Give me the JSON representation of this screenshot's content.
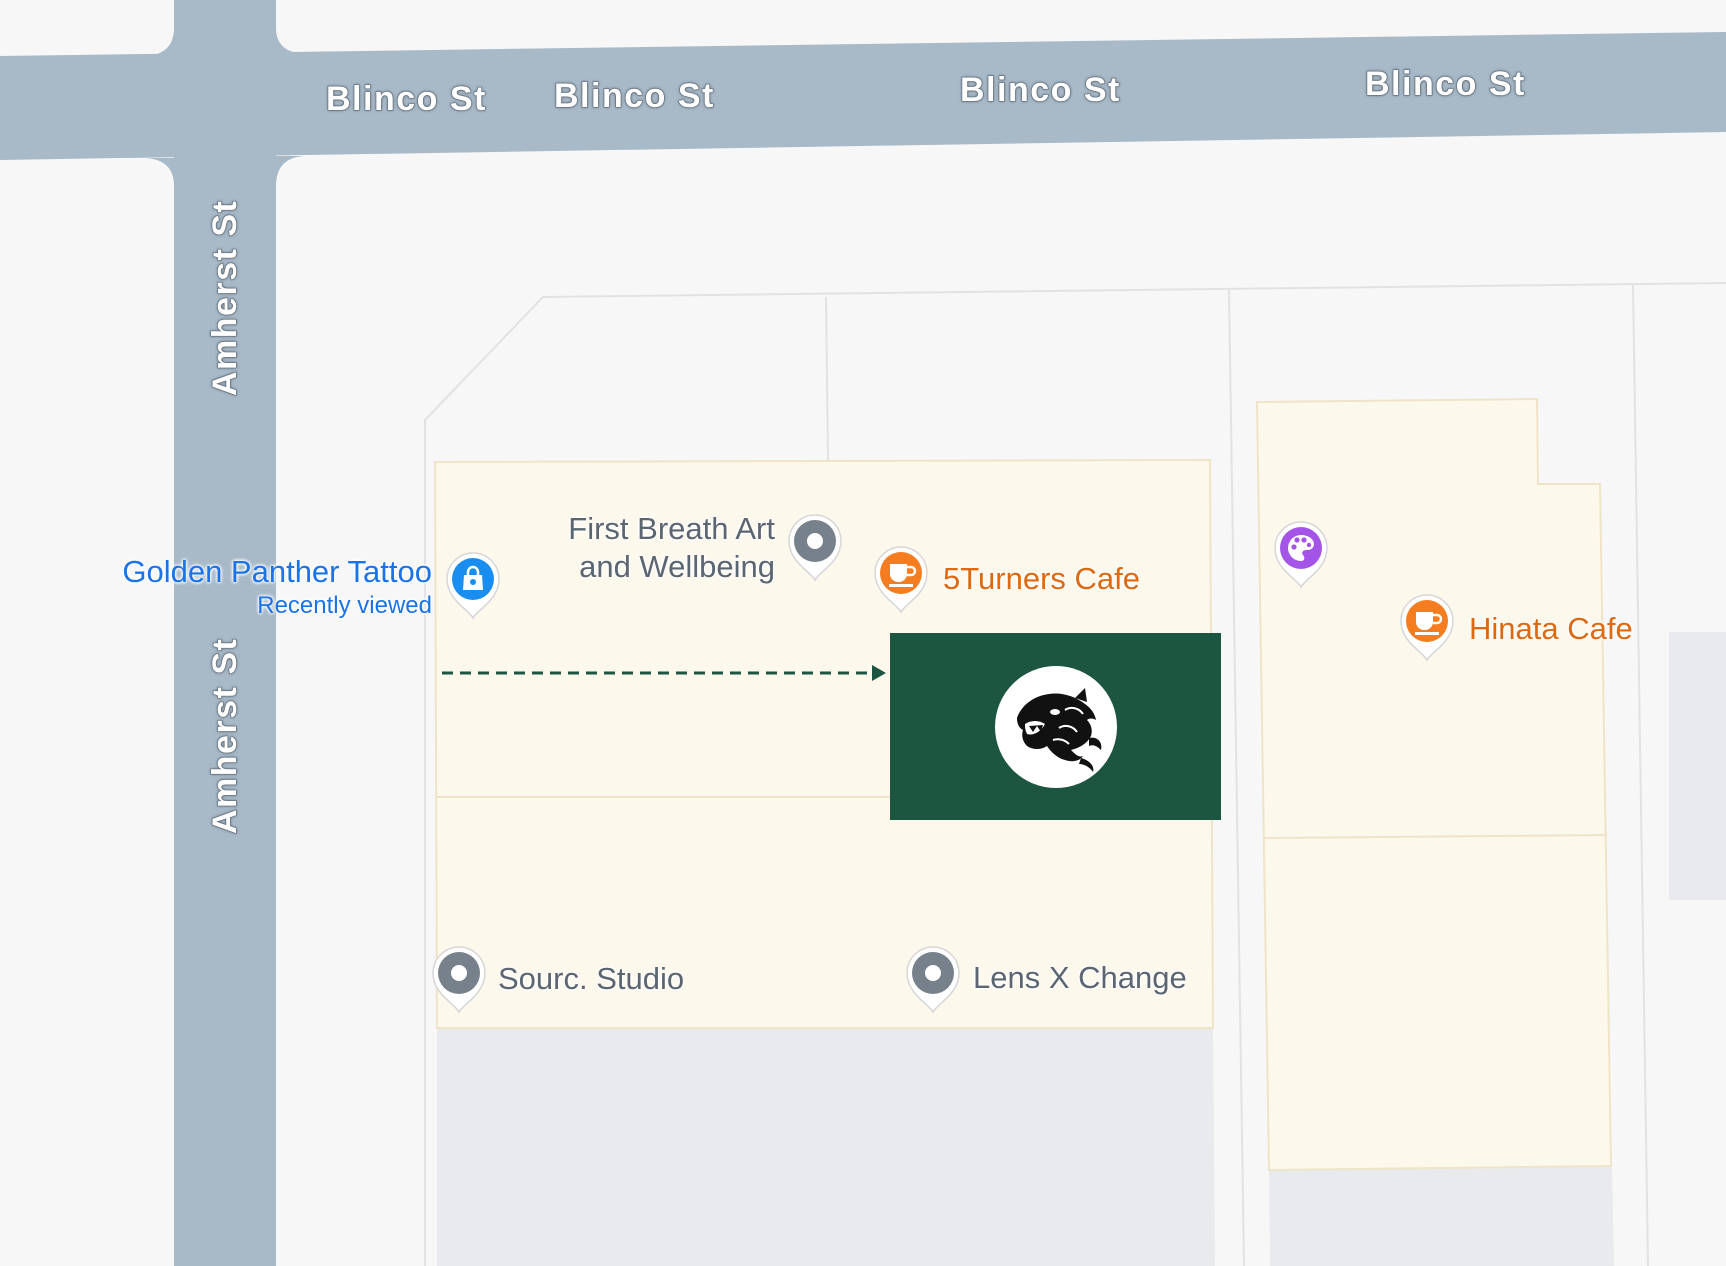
{
  "colors": {
    "road": "#a8b9c8",
    "background": "#f7f7f7",
    "building": "#fdf8ec",
    "building_outline": "#efe4c7",
    "lot": "#e8eaed",
    "parcel_line": "#e2e2e2",
    "gray_pin": "#76818b",
    "orange_pin": "#f57c1f",
    "blue_pin": "#1a8ef0",
    "purple_pin": "#a455e8",
    "overlay_green": "#1c5540",
    "arrow_green": "#1c5540"
  },
  "streets": {
    "blinco": [
      "Blinco St",
      "Blinco St",
      "Blinco St",
      "Blinco St"
    ],
    "amherst": [
      "Amherst St",
      "Amherst St"
    ]
  },
  "places": {
    "golden_panther": {
      "name": "Golden Panther Tattoo",
      "sub": "Recently viewed",
      "icon": "shopping-bag-icon"
    },
    "first_breath": {
      "line1": "First Breath Art",
      "line2": "and Wellbeing",
      "icon": "place-pin-icon"
    },
    "five_turners": {
      "name": "5Turners Cafe",
      "icon": "coffee-cup-icon"
    },
    "hinata": {
      "name": "Hinata Cafe",
      "icon": "coffee-cup-icon"
    },
    "art_gallery": {
      "icon": "palette-icon"
    },
    "sourc_studio": {
      "name": "Sourc. Studio",
      "icon": "place-pin-icon"
    },
    "lens_x_change": {
      "name": "Lens X Change",
      "icon": "place-pin-icon"
    }
  },
  "overlay": {
    "icon": "panther-head-icon"
  }
}
